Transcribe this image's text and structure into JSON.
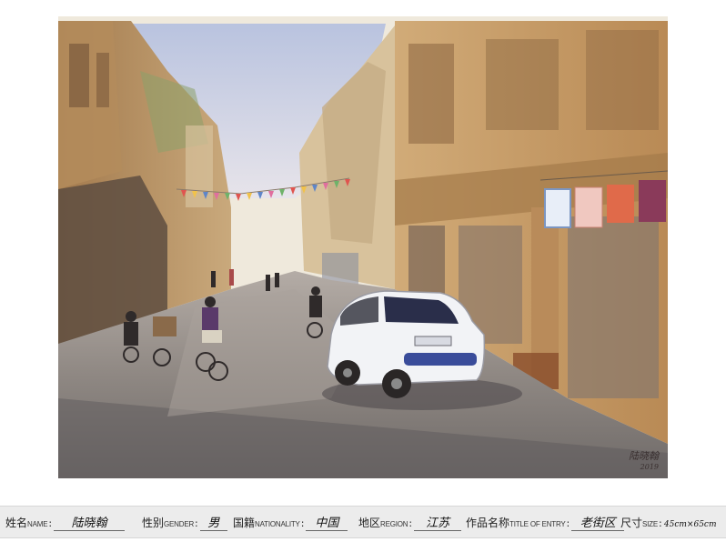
{
  "artwork": {
    "signature": "陆晓翰",
    "signature_date": "2019"
  },
  "caption": {
    "name": {
      "label_cn": "姓名",
      "label_en": "NAME",
      "value": "陆晓翰"
    },
    "gender": {
      "label_cn": "性别",
      "label_en": "GENDER",
      "value": "男"
    },
    "nationality": {
      "label_cn": "国籍",
      "label_en": "NATIONALITY",
      "value": "中国"
    },
    "region": {
      "label_cn": "地区",
      "label_en": "REGION",
      "value": "江苏"
    },
    "title": {
      "label_cn": "作品名称",
      "label_en": "TITLE OF ENTRY",
      "value": "老街区"
    },
    "size": {
      "label_cn": "尺寸",
      "label_en": "SIZE",
      "value": "45cm×65cm"
    }
  },
  "colors": {
    "sky": "#c9cfe4",
    "building_ochre": "#c9a06b",
    "shadow_brown": "#6b5a4a",
    "road_grey": "#8e8a86",
    "car_white": "#f2f3f6",
    "car_blue": "#3a4c9a",
    "caption_bg": "#ececec"
  }
}
